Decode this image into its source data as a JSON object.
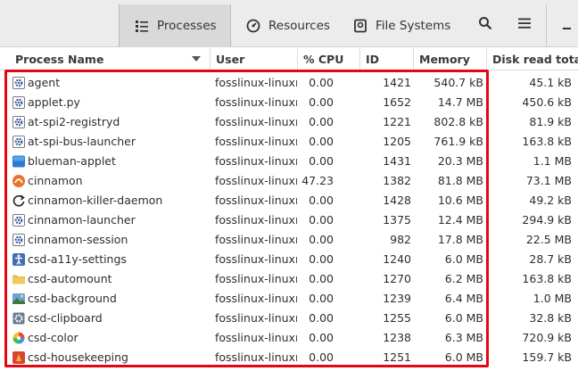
{
  "header": {
    "tabs": [
      {
        "label": "Processes",
        "active": true,
        "icon": "list-icon"
      },
      {
        "label": "Resources",
        "active": false,
        "icon": "gauge-icon"
      },
      {
        "label": "File Systems",
        "active": false,
        "icon": "drive-icon"
      }
    ],
    "buttons": [
      "search-icon",
      "hamburger-menu-icon",
      "minimize-icon"
    ]
  },
  "columns": [
    "Process Name",
    "User",
    "% CPU",
    "ID",
    "Memory",
    "Disk read total"
  ],
  "rows": [
    {
      "name": "agent",
      "user": "fosslinux-linuxmint",
      "cpu": "0.00",
      "id": "1421",
      "memory": "540.7 kB",
      "disk": "45.1 kB",
      "icon": "gear-doc-icon"
    },
    {
      "name": "applet.py",
      "user": "fosslinux-linuxmint",
      "cpu": "0.00",
      "id": "1652",
      "memory": "14.7 MB",
      "disk": "450.6 kB",
      "icon": "gear-doc-icon"
    },
    {
      "name": "at-spi2-registryd",
      "user": "fosslinux-linuxmint",
      "cpu": "0.00",
      "id": "1221",
      "memory": "802.8 kB",
      "disk": "81.9 kB",
      "icon": "gear-doc-icon"
    },
    {
      "name": "at-spi-bus-launcher",
      "user": "fosslinux-linuxmint",
      "cpu": "0.00",
      "id": "1205",
      "memory": "761.9 kB",
      "disk": "163.8 kB",
      "icon": "gear-doc-icon"
    },
    {
      "name": "blueman-applet",
      "user": "fosslinux-linuxmint",
      "cpu": "0.00",
      "id": "1431",
      "memory": "20.3 MB",
      "disk": "1.1 MB",
      "icon": "blue-square-icon"
    },
    {
      "name": "cinnamon",
      "user": "fosslinux-linuxmint",
      "cpu": "47.23",
      "id": "1382",
      "memory": "81.8 MB",
      "disk": "73.1 MB",
      "icon": "cinnamon-icon"
    },
    {
      "name": "cinnamon-killer-daemon",
      "user": "fosslinux-linuxmint",
      "cpu": "0.00",
      "id": "1428",
      "memory": "10.6 MB",
      "disk": "49.2 kB",
      "icon": "refresh-icon"
    },
    {
      "name": "cinnamon-launcher",
      "user": "fosslinux-linuxmint",
      "cpu": "0.00",
      "id": "1375",
      "memory": "12.4 MB",
      "disk": "294.9 kB",
      "icon": "gear-doc-icon"
    },
    {
      "name": "cinnamon-session",
      "user": "fosslinux-linuxmint",
      "cpu": "0.00",
      "id": "982",
      "memory": "17.8 MB",
      "disk": "22.5 MB",
      "icon": "gear-doc-icon"
    },
    {
      "name": "csd-a11y-settings",
      "user": "fosslinux-linuxmint",
      "cpu": "0.00",
      "id": "1240",
      "memory": "6.0 MB",
      "disk": "28.7 kB",
      "icon": "accessibility-icon"
    },
    {
      "name": "csd-automount",
      "user": "fosslinux-linuxmint",
      "cpu": "0.00",
      "id": "1270",
      "memory": "6.2 MB",
      "disk": "163.8 kB",
      "icon": "folder-icon"
    },
    {
      "name": "csd-background",
      "user": "fosslinux-linuxmint",
      "cpu": "0.00",
      "id": "1239",
      "memory": "6.4 MB",
      "disk": "1.0 MB",
      "icon": "wallpaper-icon"
    },
    {
      "name": "csd-clipboard",
      "user": "fosslinux-linuxmint",
      "cpu": "0.00",
      "id": "1255",
      "memory": "6.0 MB",
      "disk": "32.8 kB",
      "icon": "gear-icon"
    },
    {
      "name": "csd-color",
      "user": "fosslinux-linuxmint",
      "cpu": "0.00",
      "id": "1238",
      "memory": "6.3 MB",
      "disk": "720.9 kB",
      "icon": "color-wheel-icon"
    },
    {
      "name": "csd-housekeeping",
      "user": "fosslinux-linuxmint",
      "cpu": "0.00",
      "id": "1251",
      "memory": "6.0 MB",
      "disk": "159.7 kB",
      "icon": "broom-icon"
    }
  ]
}
